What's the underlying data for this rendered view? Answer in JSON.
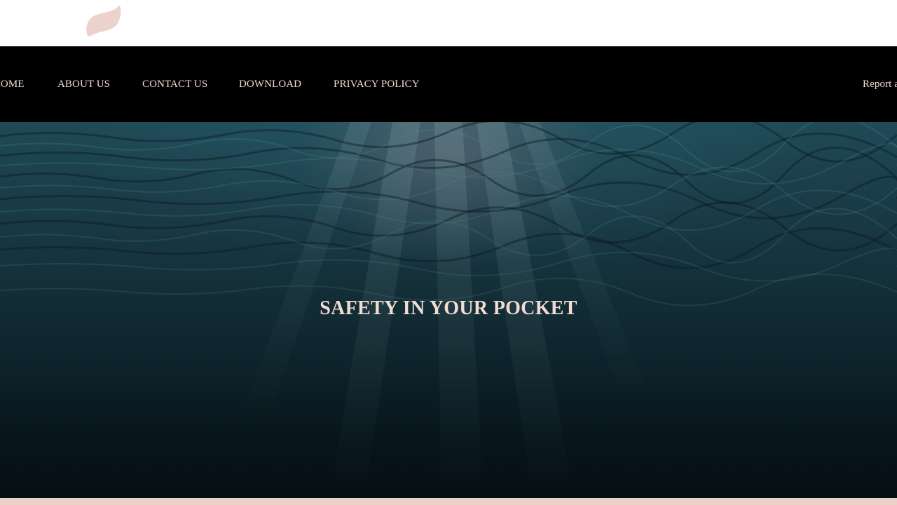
{
  "header": {
    "logo_icon": "feather-logo-icon",
    "logo_color": "#ecd2cc"
  },
  "nav": {
    "background": "#000000",
    "text_color": "#f1dcd4",
    "items": [
      {
        "label": "HOME"
      },
      {
        "label": "ABOUT US"
      },
      {
        "label": "CONTACT US"
      },
      {
        "label": "DOWNLOAD"
      },
      {
        "label": "PRIVACY POLICY"
      }
    ],
    "right_link": "Report an"
  },
  "hero": {
    "title": "SAFETY IN YOUR POCKET",
    "background_image": "underwater-light-rays"
  },
  "footer_strip_color": "#ead2cb"
}
